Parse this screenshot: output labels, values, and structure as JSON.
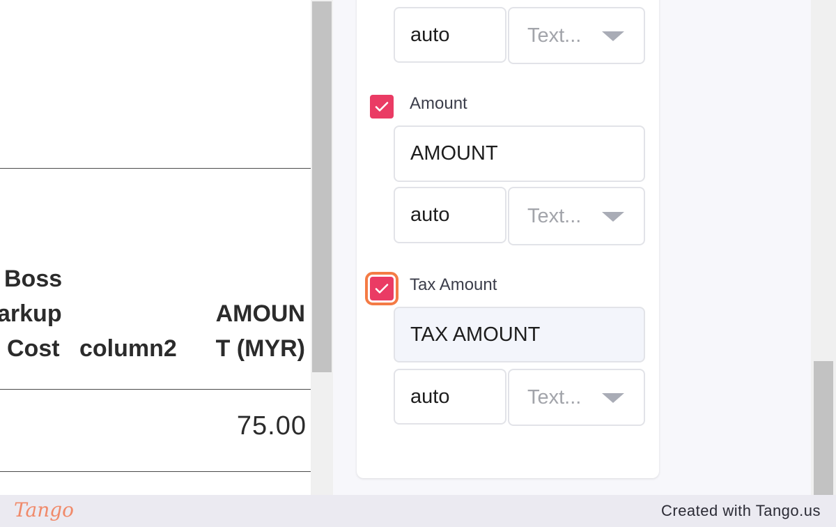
{
  "preview": {
    "headers": {
      "boss_markup_cost": [
        "Boss",
        "arkup",
        "Cost"
      ],
      "column2": "column2",
      "amount_myr": [
        "AMOUN",
        "T (MYR)"
      ]
    },
    "row_amount": "75.00"
  },
  "panel": {
    "top_row": {
      "width_value": "auto",
      "format_placeholder": "Text..."
    },
    "amount": {
      "label": "Amount",
      "checked": true,
      "header_value": "AMOUNT",
      "width_value": "auto",
      "format_placeholder": "Text..."
    },
    "tax_amount": {
      "label": "Tax Amount",
      "checked": true,
      "header_value": "TAX AMOUNT",
      "width_value": "auto",
      "format_placeholder": "Text..."
    }
  },
  "footer": {
    "logo_text": "Tango",
    "credit": "Created with Tango.us"
  },
  "colors": {
    "checkbox": "#ea3b64",
    "highlight": "#f47b45"
  },
  "icons": [
    "checkmark-icon",
    "chevron-down-icon"
  ]
}
